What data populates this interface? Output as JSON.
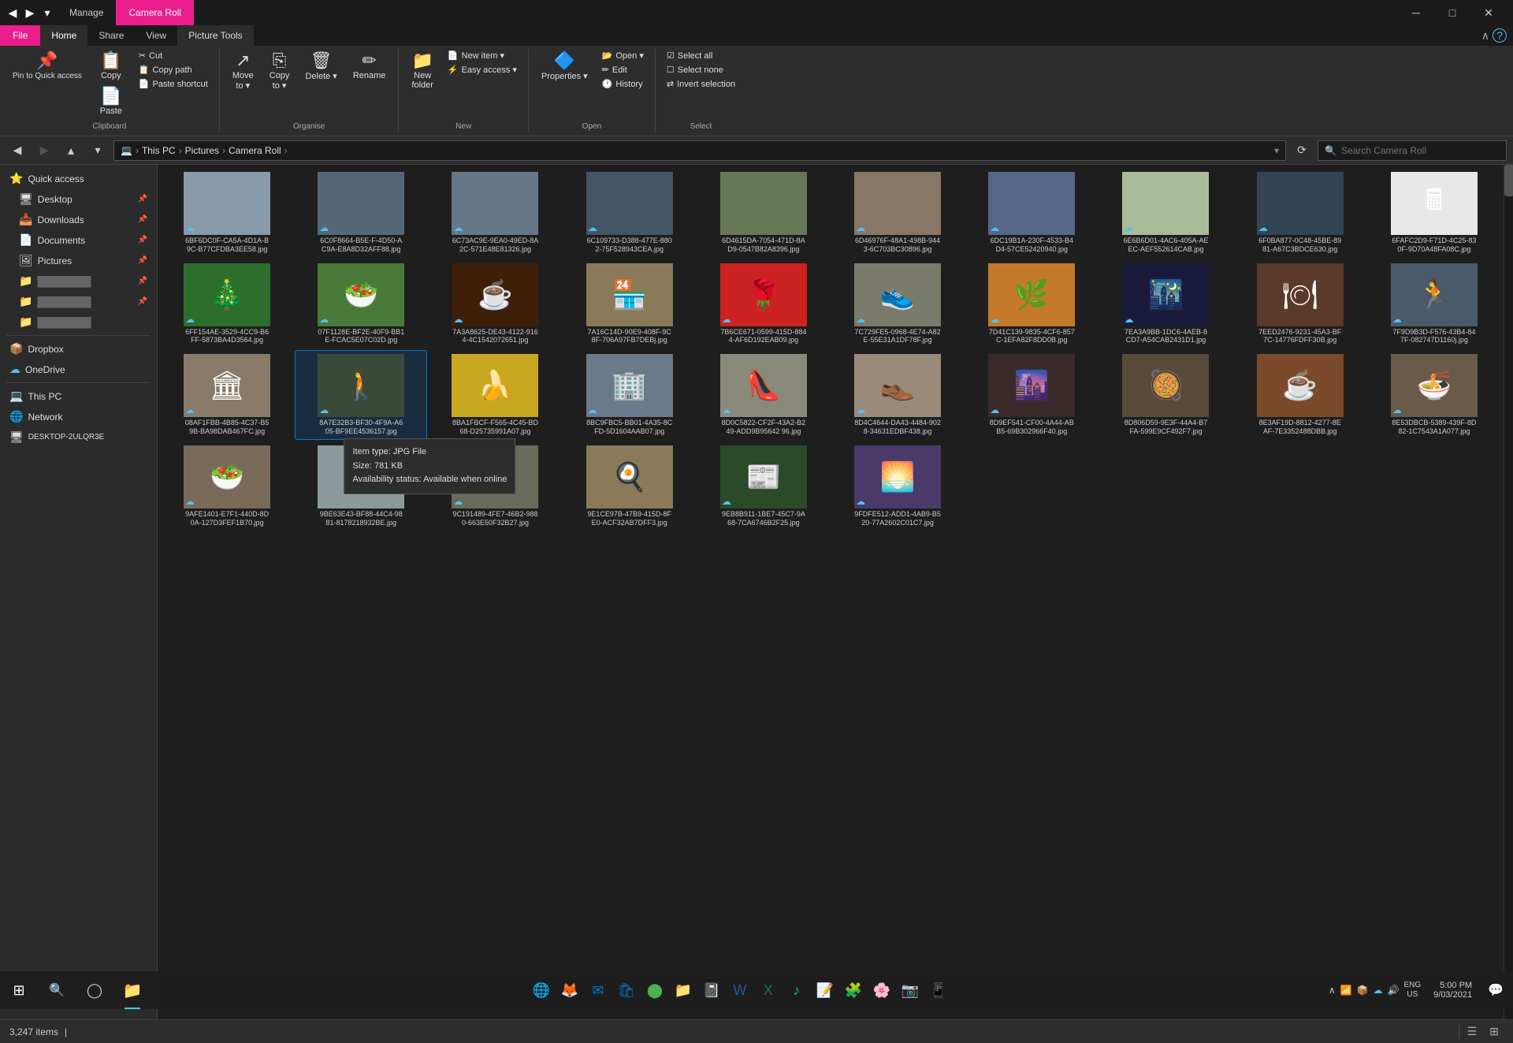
{
  "titleBar": {
    "tabs": [
      {
        "id": "manage",
        "label": "Manage"
      },
      {
        "id": "camera-roll",
        "label": "Camera Roll"
      }
    ],
    "controls": [
      "─",
      "□",
      "✕"
    ]
  },
  "ribbon": {
    "tabs": [
      {
        "id": "file",
        "label": "File"
      },
      {
        "id": "home",
        "label": "Home",
        "active": true
      },
      {
        "id": "share",
        "label": "Share"
      },
      {
        "id": "view",
        "label": "View"
      },
      {
        "id": "picture-tools",
        "label": "Picture Tools"
      }
    ],
    "groups": {
      "clipboard": {
        "label": "Clipboard",
        "buttons": [
          {
            "id": "pin-to-quick-access",
            "icon": "📌",
            "label": "Pin to Quick\naccess"
          },
          {
            "id": "copy",
            "icon": "📋",
            "label": "Copy"
          },
          {
            "id": "paste",
            "icon": "📄",
            "label": "Paste"
          }
        ],
        "smallButtons": [
          {
            "id": "cut",
            "icon": "✂",
            "label": "Cut"
          },
          {
            "id": "copy-path",
            "icon": "📋",
            "label": "Copy path"
          },
          {
            "id": "paste-shortcut",
            "icon": "📄",
            "label": "Paste shortcut"
          }
        ]
      },
      "organise": {
        "label": "Organise",
        "buttons": [
          {
            "id": "move-to",
            "icon": "↗",
            "label": "Move to ▾"
          },
          {
            "id": "copy-to",
            "icon": "⎘",
            "label": "Copy to ▾"
          },
          {
            "id": "delete",
            "icon": "🗑",
            "label": "Delete ▾"
          },
          {
            "id": "rename",
            "icon": "✏",
            "label": "Rename"
          }
        ]
      },
      "new": {
        "label": "New",
        "buttons": [
          {
            "id": "new-folder",
            "icon": "📁",
            "label": "New\nfolder"
          },
          {
            "id": "new-item",
            "icon": "📄",
            "label": "New item ▾"
          },
          {
            "id": "easy-access",
            "icon": "⚡",
            "label": "Easy access ▾"
          }
        ]
      },
      "open": {
        "label": "Open",
        "buttons": [
          {
            "id": "properties",
            "icon": "🔷",
            "label": "Properties ▾"
          },
          {
            "id": "open",
            "icon": "📂",
            "label": "Open ▾"
          },
          {
            "id": "edit",
            "icon": "✏",
            "label": "Edit"
          },
          {
            "id": "history",
            "icon": "🕐",
            "label": "History"
          }
        ]
      },
      "select": {
        "label": "Select",
        "buttons": [
          {
            "id": "select-all",
            "icon": "☑",
            "label": "Select all"
          },
          {
            "id": "select-none",
            "icon": "☐",
            "label": "Select none"
          },
          {
            "id": "invert-selection",
            "icon": "⇄",
            "label": "Invert selection"
          }
        ]
      }
    }
  },
  "addressBar": {
    "backDisabled": false,
    "forwardDisabled": true,
    "upDisabled": false,
    "path": [
      "This PC",
      "Pictures",
      "Camera Roll"
    ],
    "searchPlaceholder": "Search Camera Roll"
  },
  "sidebar": {
    "items": [
      {
        "id": "quick-access",
        "icon": "⭐",
        "label": "Quick access",
        "expanded": true,
        "pinned": false
      },
      {
        "id": "desktop",
        "icon": "🖥",
        "label": "Desktop",
        "pinned": true
      },
      {
        "id": "downloads",
        "icon": "📥",
        "label": "Downloads",
        "pinned": true
      },
      {
        "id": "documents",
        "icon": "📄",
        "label": "Documents",
        "pinned": true
      },
      {
        "id": "pictures",
        "icon": "🖼",
        "label": "Pictures",
        "pinned": true
      },
      {
        "id": "folder1",
        "icon": "📁",
        "label": "",
        "pinned": false
      },
      {
        "id": "folder2",
        "icon": "📁",
        "label": "",
        "pinned": false
      },
      {
        "id": "folder3",
        "icon": "📁",
        "label": "",
        "pinned": false
      },
      {
        "id": "dropbox",
        "icon": "📦",
        "label": "Dropbox",
        "pinned": false
      },
      {
        "id": "onedrive",
        "icon": "☁",
        "label": "OneDrive",
        "pinned": false
      },
      {
        "id": "this-pc",
        "icon": "💻",
        "label": "This PC",
        "pinned": false
      },
      {
        "id": "network",
        "icon": "🌐",
        "label": "Network",
        "pinned": false
      },
      {
        "id": "desktop-name",
        "icon": "🖥",
        "label": "DESKTOP-2ULQR3E",
        "pinned": false
      }
    ]
  },
  "files": [
    {
      "id": 1,
      "name": "6BF6DC0F-CA5A-4D1A-B9C-B77CFDBA3EE58.jpg",
      "thumb_color": "#8899aa",
      "cloud": true
    },
    {
      "id": 2,
      "name": "6C0F8664-B5E-F-4D50-AC9A-E8A8D32AFF88.jpg",
      "thumb_color": "#556677",
      "cloud": true
    },
    {
      "id": 3,
      "name": "6C73AC9E-9EA0-49ED-8A2C-571E48E81326.jpg",
      "thumb_color": "#667788",
      "cloud": true
    },
    {
      "id": 4,
      "name": "6C109733-D388-477E-8802-75F528943CEA.jpg",
      "thumb_color": "#445566",
      "cloud": true
    },
    {
      "id": 5,
      "name": "6D4615DA-7054-471D-8AD9-0547B82A8396.jpg",
      "thumb_color": "#667755",
      "cloud": false
    },
    {
      "id": 6,
      "name": "6D46976F-48A1-498B-9443-6C703BC30896.jpg",
      "thumb_color": "#887766",
      "cloud": true
    },
    {
      "id": 7,
      "name": "6DC19B1A-230F-4533-B4D4-57CE52420940.jpg",
      "thumb_color": "#556688",
      "cloud": true
    },
    {
      "id": 8,
      "name": "6E6B6D01-4AC6-405A-AEEC-AEF552614CAB.jpg",
      "thumb_color": "#aabb99",
      "cloud": true
    },
    {
      "id": 9,
      "name": "6F0BA877-0C48-45BE-8981-A67C3BDCE630.jpg",
      "thumb_color": "#334455",
      "cloud": true
    },
    {
      "id": 10,
      "name": "6FAFC2D9-F71D-4C25-830F-9D70A48FA08C.jpg",
      "thumb_type": "calc",
      "cloud": false
    },
    {
      "id": 11,
      "name": "6FF154AE-3529-4CC9-B6FF-5873BA4D3564.jpg",
      "thumb_type": "xmas",
      "cloud": true
    },
    {
      "id": 12,
      "name": "07F1128E-BF2E-40F9-BB1E-FCAC5E07C02D.jpg",
      "thumb_type": "salad",
      "cloud": true
    },
    {
      "id": 13,
      "name": "7A3A8625-DE43-4122-9164-4C1542072651.jpg",
      "thumb_type": "coffee",
      "cloud": true
    },
    {
      "id": 14,
      "name": "7A16C14D-90E9-408F-9C8F-706A97FB7DEBj.jpg",
      "thumb_type": "market",
      "cloud": false
    },
    {
      "id": 15,
      "name": "7B6CE671-0599-415D-8844-AF6D192EAB09.jpg",
      "thumb_type": "flower",
      "cloud": true
    },
    {
      "id": 16,
      "name": "7C729FE5-0968-4E74-A82E-55E31A1DF78F.jpg",
      "thumb_type": "shoe1",
      "cloud": true
    },
    {
      "id": 17,
      "name": "7D41C139-9835-4CF6-857C-1EFA82F8DD0B.jpg",
      "thumb_type": "spice",
      "cloud": true
    },
    {
      "id": 18,
      "name": "7EA3A9BB-1DC6-4AEB-8CD7-A54CAB2431D1.jpg",
      "thumb_type": "night",
      "cloud": true
    },
    {
      "id": 19,
      "name": "7EED2476-9231-45A3-BF7C-14776FDFF30B.jpg",
      "thumb_type": "food1",
      "cloud": false
    },
    {
      "id": 20,
      "name": "7F9D9B3D-F576-43B4-847F-082747D1160j.jpg",
      "thumb_type": "road",
      "cloud": true
    },
    {
      "id": 21,
      "name": "08AF1FBB-4B85-4C37-B59B-BA98DAB467FC.jpg",
      "thumb_type": "museum",
      "cloud": true
    },
    {
      "id": 22,
      "name": "8A7E32B3-BF30-4F9A-A605-BF9EE4536157.jpg",
      "thumb_type": "street",
      "cloud": true,
      "selected": true,
      "showTooltip": true
    },
    {
      "id": 23,
      "name": "8BA1FBCF-F565-4C45-BD68-D25735991A07.jpg",
      "thumb_type": "banana",
      "cloud": false
    },
    {
      "id": 24,
      "name": "8BC9FBC5-BB01-4A35-8CFD-5D1604AAB07.jpg",
      "thumb_type": "building",
      "cloud": true
    },
    {
      "id": 25,
      "name": "8D0C5822-CF2F-43A2-B249-ADD9B95642 96.jpg",
      "thumb_type": "shoe2",
      "cloud": true
    },
    {
      "id": 26,
      "name": "8D4C4644-DA43-4484-9028-34631EDBF438.jpg",
      "thumb_type": "shoe3",
      "cloud": true
    },
    {
      "id": 27,
      "name": "8D9EF541-CF00-4A44-ABB5-69B302966F40.jpg",
      "thumb_type": "alley",
      "cloud": true
    },
    {
      "id": 28,
      "name": "8D806D59-9E3F-44A4-B7FA-599E9CF492F7.jpg",
      "thumb_type": "plate1",
      "cloud": false
    },
    {
      "id": 29,
      "name": "8E3AF19D-8812-4277-8EAF-7E3352488DBB.jpg",
      "thumb_type": "cup",
      "cloud": false
    },
    {
      "id": 30,
      "name": "8E53DBCB-5389-439F-8D82-1C7543A1A077.jpg",
      "thumb_type": "food2",
      "cloud": true
    },
    {
      "id": 31,
      "name": "9AFE1401-E7F1-440D-8D0A-127D3FEF1B70.jpg",
      "thumb_type": "food3",
      "cloud": true
    },
    {
      "id": 32,
      "name": "9BE63E43-BF88-44C4-9881-8178218932BE.jpg",
      "thumb_type": "oyster",
      "cloud": false
    },
    {
      "id": 33,
      "name": "9C191489-4FE7-46B2-9880-663E50F32B27.jpg",
      "thumb_type": "statue",
      "cloud": true
    },
    {
      "id": 34,
      "name": "9E1CE97B-47B9-415D-8FE0-ACF32AB7DFF3.jpg",
      "thumb_type": "breakfast",
      "cloud": false
    },
    {
      "id": 35,
      "name": "9EB8B911-1BE7-45C7-9A68-7CA6746B2F25.jpg",
      "thumb_type": "magazine",
      "cloud": true
    },
    {
      "id": 36,
      "name": "9FDFE512-ADD1-4AB9-B520-77A2602C01C7.jpg",
      "thumb_type": "sunset",
      "cloud": true
    }
  ],
  "tooltip": {
    "itemType": "Item type: JPG File",
    "size": "Size: 781 KB",
    "availability": "Availability status: Available when online"
  },
  "statusBar": {
    "itemCount": "3,247 items",
    "separator": "|"
  },
  "taskbar": {
    "time": "5:00 PM",
    "date": "9/03/2021",
    "language": "ENG\nUS"
  }
}
